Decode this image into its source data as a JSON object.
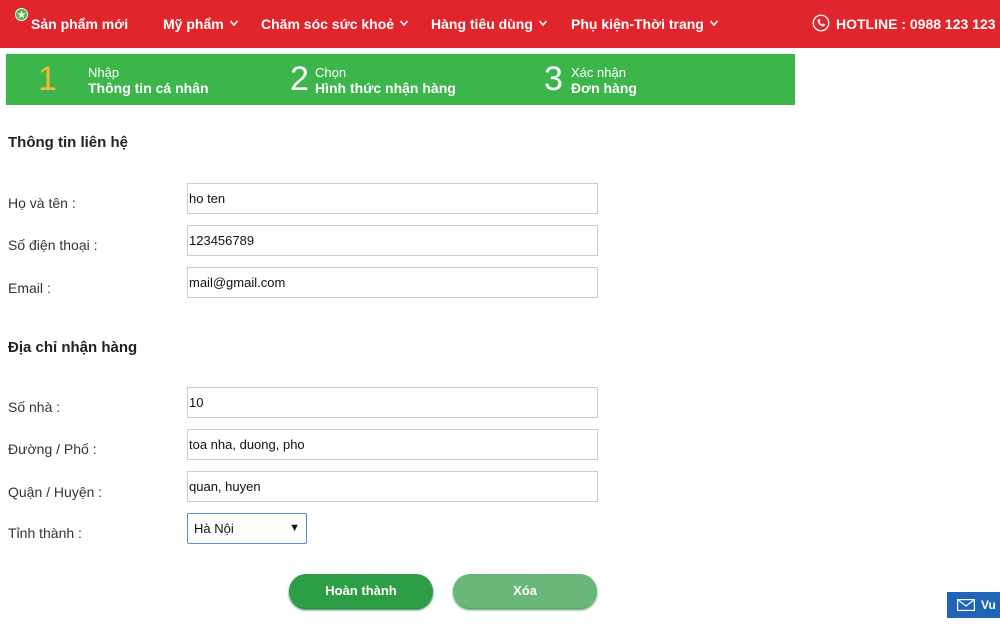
{
  "nav": {
    "new_products": "Sản phẩm mới",
    "cosmetics": "Mỹ phẩm",
    "health_care": "Chăm sóc sức khoẻ",
    "consumer_goods": "Hàng tiêu dùng",
    "accessories": "Phụ kiện-Thời trang",
    "hotline": "HOTLINE : 0988 123 123"
  },
  "steps": [
    {
      "number": "1",
      "line1": "Nhập",
      "line2": "Thông tin cá nhân"
    },
    {
      "number": "2",
      "line1": "Chọn",
      "line2": "Hình thức nhận hàng"
    },
    {
      "number": "3",
      "line1": "Xác nhận",
      "line2": "Đơn hàng"
    }
  ],
  "contact": {
    "title": "Thông tin liên hệ",
    "name_label": "Họ và tên :",
    "name_value": "ho ten",
    "phone_label": "Số điện thoại :",
    "phone_value": "123456789",
    "email_label": "Email :",
    "email_value": "mail@gmail.com"
  },
  "address": {
    "title": "Địa chỉ nhận hàng",
    "house_label": "Số nhà :",
    "house_value": "10",
    "street_label": "Đường / Phố :",
    "street_value": "toa nha, duong, pho",
    "district_label": "Quận / Huyện :",
    "district_value": "quan, huyen",
    "province_label": "Tỉnh thành :",
    "province_value": "Hà Nội"
  },
  "buttons": {
    "complete": "Hoàn thành",
    "clear": "Xóa"
  },
  "chat_tab": "Vu",
  "colors": {
    "nav_bg": "#e0262c",
    "steps_bg": "#3cb54a",
    "active_step_number": "#f5b731",
    "primary_button": "#2e9e46",
    "secondary_button": "#6ab77a",
    "chat_tab_bg": "#1f64b5"
  },
  "icons": {
    "new": "star-badge-icon",
    "dropdown": "chevron-down-icon",
    "hotline": "phone-icon",
    "chat": "mail-icon"
  }
}
